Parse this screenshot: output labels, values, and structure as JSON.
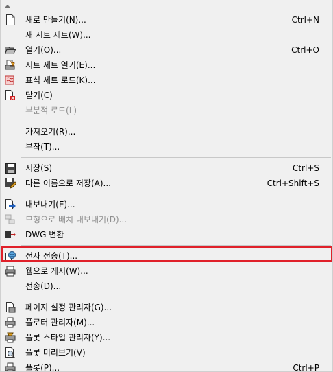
{
  "menu": {
    "items": [
      {
        "label": "새로 만들기(N)...",
        "shortcut": "Ctrl+N",
        "icon": "new-file-icon"
      },
      {
        "label": "새 시트 세트(W)...",
        "shortcut": "",
        "icon": ""
      },
      {
        "label": "열기(O)...",
        "shortcut": "Ctrl+O",
        "icon": "open-folder-icon"
      },
      {
        "label": "시트 세트 열기(E)...",
        "shortcut": "",
        "icon": "open-sheet-set-icon"
      },
      {
        "label": "표식 세트 로드(K)...",
        "shortcut": "",
        "icon": "markup-set-icon"
      },
      {
        "label": "닫기(C)",
        "shortcut": "",
        "icon": "close-file-icon"
      },
      {
        "label": "부분적 로드(L)",
        "shortcut": "",
        "icon": "",
        "disabled": true
      },
      {
        "label": "가져오기(R)...",
        "shortcut": "",
        "icon": ""
      },
      {
        "label": "부착(T)...",
        "shortcut": "",
        "icon": ""
      },
      {
        "label": "저장(S)",
        "shortcut": "Ctrl+S",
        "icon": "save-icon"
      },
      {
        "label": "다른 이름으로 저장(A)...",
        "shortcut": "Ctrl+Shift+S",
        "icon": "save-as-icon"
      },
      {
        "label": "내보내기(E)...",
        "shortcut": "",
        "icon": "export-icon"
      },
      {
        "label": "모형으로 배치 내보내기(D)...",
        "shortcut": "",
        "icon": "export-layout-icon",
        "disabled": true
      },
      {
        "label": "DWG 변환",
        "shortcut": "",
        "icon": "dwg-convert-icon"
      },
      {
        "label": "전자 전송(T)...",
        "shortcut": "",
        "icon": "etransmit-icon"
      },
      {
        "label": "웹으로 게시(W)...",
        "shortcut": "",
        "icon": "publish-web-icon"
      },
      {
        "label": "전송(D)...",
        "shortcut": "",
        "icon": ""
      },
      {
        "label": "페이지 설정 관리자(G)...",
        "shortcut": "",
        "icon": "page-setup-icon"
      },
      {
        "label": "플로터 관리자(M)...",
        "shortcut": "",
        "icon": "plotter-manager-icon"
      },
      {
        "label": "플롯 스타일 관리자(Y)...",
        "shortcut": "",
        "icon": "plot-style-icon"
      },
      {
        "label": "플롯 미리보기(V)",
        "shortcut": "",
        "icon": "plot-preview-icon"
      },
      {
        "label": "플롯(P)...",
        "shortcut": "Ctrl+P",
        "icon": "plot-icon"
      }
    ]
  },
  "colors": {
    "highlight": "#e0202a",
    "disabled_text": "#8d8d8d",
    "menu_bg": "#f0f0f0"
  }
}
